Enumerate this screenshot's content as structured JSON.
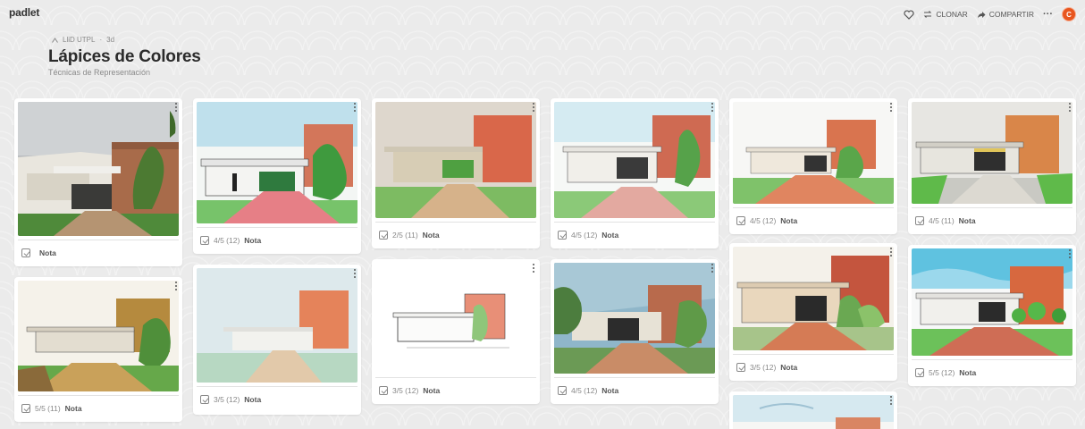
{
  "topbar": {
    "logo": "padlet",
    "clone_label": "CLONAR",
    "share_label": "COMPARTIR",
    "more_label": "···",
    "avatar_initial": "C"
  },
  "header": {
    "breadcrumb_owner": "LliD UTPL",
    "breadcrumb_time": "3d",
    "title": "Lápices de Colores",
    "subtitle": "Técnicas de Representación"
  },
  "colors": {
    "avatar": "#e8561f",
    "background": "#ebebeb",
    "card": "#ffffff",
    "brick": "#c86a48",
    "grass": "#5fa845",
    "sky": "#a9cfe6"
  },
  "cards": [
    {
      "grade": "",
      "note": "Nota",
      "image": "photo"
    },
    {
      "grade": "5/5 (11)",
      "note": "Nota",
      "image": "sketch"
    },
    {
      "grade": "4/5 (12)",
      "note": "Nota",
      "image": "sketch"
    },
    {
      "grade": "3/5 (12)",
      "note": "Nota",
      "image": "sketch"
    },
    {
      "grade": "2/5 (11)",
      "note": "Nota",
      "image": "sketch"
    },
    {
      "grade": "3/5 (12)",
      "note": "Nota",
      "image": "sketch"
    },
    {
      "grade": "4/5 (12)",
      "note": "Nota",
      "image": "sketch"
    },
    {
      "grade": "4/5 (12)",
      "note": "Nota",
      "image": "sketch"
    },
    {
      "grade": "4/5 (12)",
      "note": "Nota",
      "image": "sketch"
    },
    {
      "grade": "3/5 (12)",
      "note": "Nota",
      "image": "sketch"
    },
    {
      "grade": "",
      "note": "",
      "image": "sketch"
    },
    {
      "grade": "4/5 (11)",
      "note": "Nota",
      "image": "sketch"
    },
    {
      "grade": "5/5 (12)",
      "note": "Nota",
      "image": "sketch"
    }
  ]
}
